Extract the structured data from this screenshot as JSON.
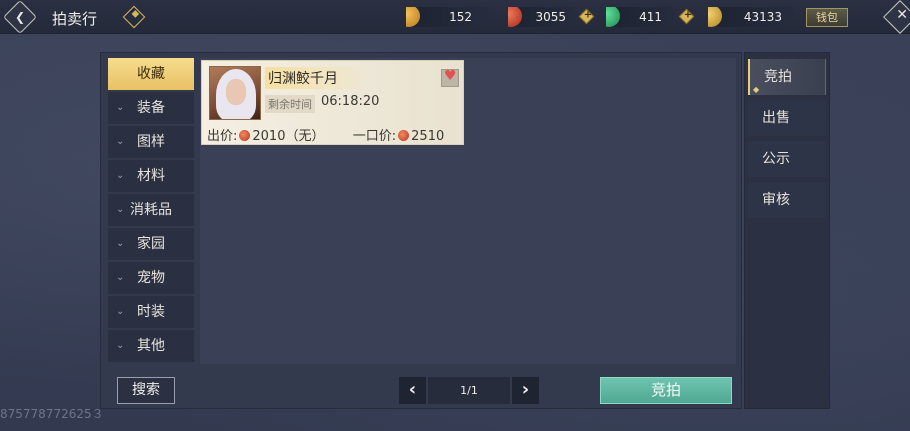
{
  "header": {
    "title": "拍卖行",
    "help_glyph": "◆",
    "currencies": [
      {
        "name": "gold-bag",
        "value": "152",
        "color": "#e8a23a"
      },
      {
        "name": "red-coin",
        "value": "3055",
        "color": "#d24a2f"
      },
      {
        "name": "jade",
        "value": "411",
        "color": "#3fbf7a"
      },
      {
        "name": "feather",
        "value": "43133",
        "color": "#e0b44a"
      }
    ],
    "plus_glyph": "+",
    "wallet_label": "钱包"
  },
  "categories": [
    {
      "label": "收藏",
      "active": true
    },
    {
      "label": "装备"
    },
    {
      "label": "图样"
    },
    {
      "label": "材料"
    },
    {
      "label": "消耗品"
    },
    {
      "label": "家园"
    },
    {
      "label": "宠物"
    },
    {
      "label": "时装"
    },
    {
      "label": "其他"
    }
  ],
  "item": {
    "name": "归渊鲛千月",
    "remain_label": "剩余时间",
    "remain_value": "06:18:20",
    "price_label": "出价:",
    "price_value": "2010（无）",
    "buyout_label": "一口价:",
    "buyout_value": "2510",
    "favorited": true
  },
  "right_tabs": [
    {
      "label": "竞拍",
      "active": true
    },
    {
      "label": "出售"
    },
    {
      "label": "公示"
    },
    {
      "label": "审核"
    }
  ],
  "footer": {
    "search_label": "搜索",
    "page": "1/1",
    "bid_label": "竞拍"
  },
  "uid": "875778772625３",
  "accent": "#e9cd7a",
  "bid_color": "#5bb5a0"
}
